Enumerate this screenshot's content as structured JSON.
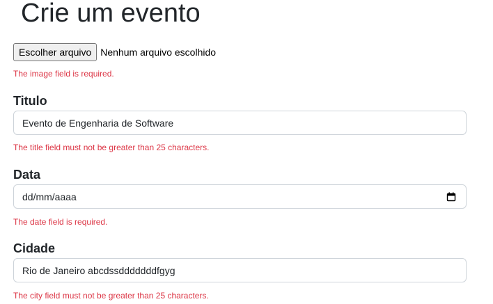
{
  "page": {
    "title": "Crie um evento"
  },
  "image": {
    "button_label": "Escolher arquivo",
    "status": "Nenhum arquivo escolhido",
    "error": "The image field is required."
  },
  "titulo": {
    "label": "Titulo",
    "value": "Evento de Engenharia de Software",
    "error": "The title field must not be greater than 25 characters."
  },
  "data": {
    "label": "Data",
    "value": "dd/mm/aaaa",
    "icon": "calendar-icon",
    "error": "The date field is required."
  },
  "cidade": {
    "label": "Cidade",
    "value": "Rio de Janeiro abcdssdddddddfgyg",
    "error": "The city field must not be greater than 25 characters."
  },
  "colors": {
    "error": "#dc3545",
    "text": "#212529",
    "border": "#ced4da"
  }
}
